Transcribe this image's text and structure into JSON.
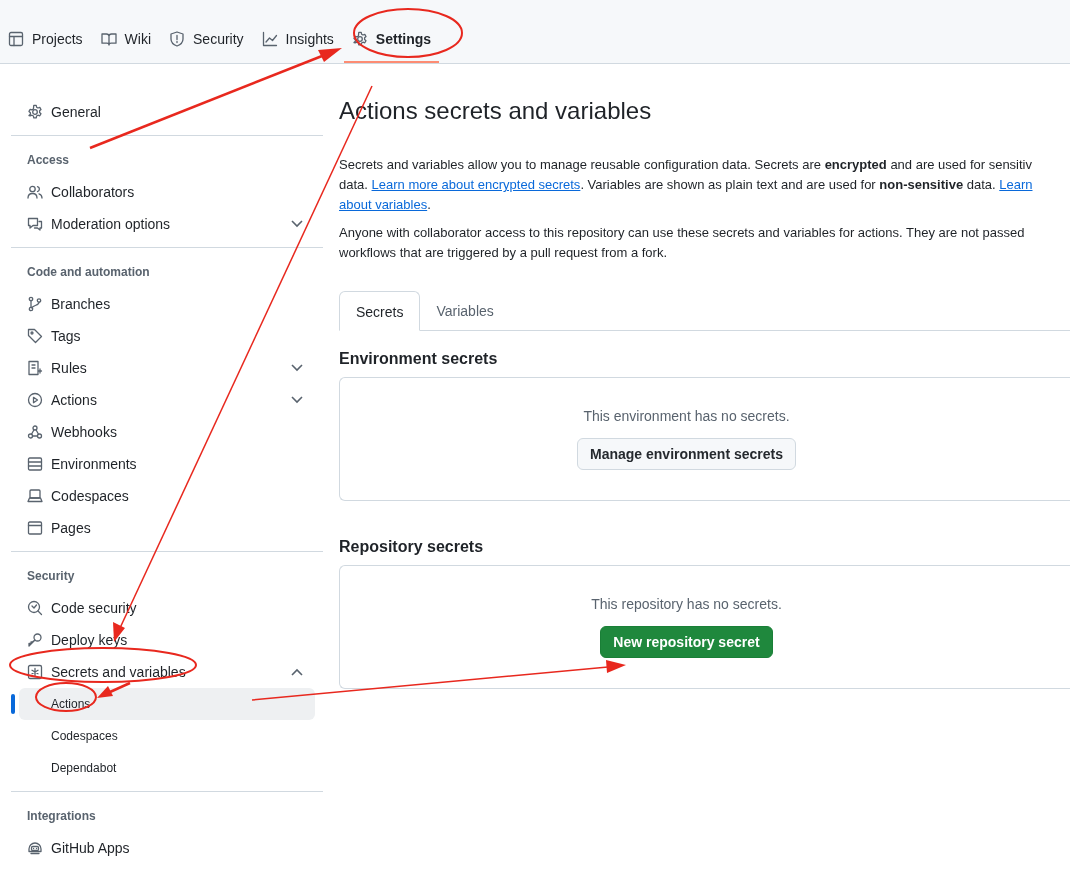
{
  "nav_tabs": [
    {
      "label": "Projects",
      "selected": false
    },
    {
      "label": "Wiki",
      "selected": false
    },
    {
      "label": "Security",
      "selected": false
    },
    {
      "label": "Insights",
      "selected": false
    },
    {
      "label": "Settings",
      "selected": true
    }
  ],
  "sidebar": [
    {
      "items": [
        {
          "label": "General",
          "selected": false
        }
      ]
    },
    {
      "heading": "Access",
      "items": [
        {
          "label": "Collaborators",
          "selected": false
        },
        {
          "label": "Moderation options",
          "selected": false,
          "expanded": false
        }
      ]
    },
    {
      "heading": "Code and automation",
      "items": [
        {
          "label": "Branches",
          "selected": false
        },
        {
          "label": "Tags",
          "selected": false
        },
        {
          "label": "Rules",
          "selected": false,
          "expanded": false
        },
        {
          "label": "Actions",
          "selected": false,
          "expanded": false
        },
        {
          "label": "Webhooks",
          "selected": false
        },
        {
          "label": "Environments",
          "selected": false
        },
        {
          "label": "Codespaces",
          "selected": false
        },
        {
          "label": "Pages",
          "selected": false
        }
      ]
    },
    {
      "heading": "Security",
      "items": [
        {
          "label": "Code security",
          "selected": false
        },
        {
          "label": "Deploy keys",
          "selected": false
        },
        {
          "label": "Secrets and variables",
          "selected": false,
          "expanded": true,
          "children": [
            {
              "label": "Actions",
              "selected": true
            },
            {
              "label": "Codespaces",
              "selected": false
            },
            {
              "label": "Dependabot",
              "selected": false
            }
          ]
        }
      ]
    },
    {
      "heading": "Integrations",
      "items": [
        {
          "label": "GitHub Apps",
          "selected": false
        }
      ]
    }
  ],
  "page": {
    "title": "Actions secrets and variables",
    "paragraphs": [
      [
        [
          {
            "kind": "text",
            "text": "Secrets and variables allow you to manage reusable configuration data. Secrets are **encrypted** and are used for sensitiv"
          }
        ],
        [
          {
            "kind": "text",
            "text": "data. "
          },
          {
            "kind": "link",
            "text": "Learn more about encrypted secrets"
          },
          {
            "kind": "text",
            "text": ". Variables are shown as plain text and are used for **non-sensitive** data. "
          },
          {
            "kind": "link",
            "text": "Learn"
          }
        ],
        [
          {
            "kind": "link",
            "text": "about variables"
          },
          {
            "kind": "text",
            "text": "."
          }
        ]
      ],
      [
        [
          {
            "kind": "text",
            "text": "Anyone with collaborator access to this repository can use these secrets and variables for actions. They are not passed"
          }
        ],
        [
          {
            "kind": "text",
            "text": "workflows that are triggered by a pull request from a fork."
          }
        ]
      ]
    ],
    "tabs": [
      {
        "label": "Secrets",
        "selected": true
      },
      {
        "label": "Variables",
        "selected": false
      }
    ],
    "sections": [
      {
        "heading": "Environment secrets",
        "empty_text": "This environment has no secrets.",
        "button": {
          "label": "Manage environment secrets",
          "kind": "default"
        }
      },
      {
        "heading": "Repository secrets",
        "empty_text": "This repository has no secrets.",
        "button": {
          "label": "New repository secret",
          "kind": "primary"
        }
      }
    ]
  }
}
